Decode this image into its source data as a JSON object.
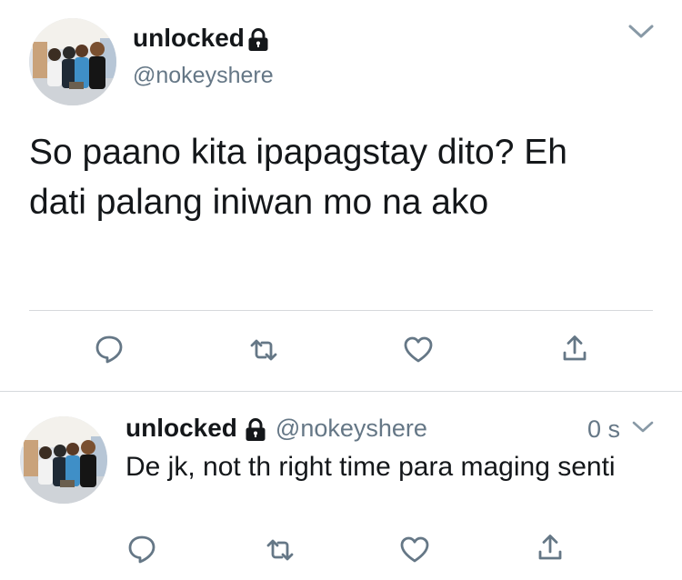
{
  "main_tweet": {
    "display_name": "unlocked",
    "handle": "@nokeyshere",
    "text": "So paano kita ipapagstay dito? Eh dati palang iniwan mo na ako"
  },
  "reply_tweet": {
    "display_name": "unlocked",
    "handle": "@nokeyshere",
    "timestamp": "0 s",
    "text": "De jk, not th right time para maging senti"
  },
  "icons": {
    "lock": "lock-icon",
    "menu": "chevron-down-icon",
    "reply": "reply-icon",
    "retweet": "retweet-icon",
    "like": "heart-icon",
    "share": "share-icon"
  },
  "colors": {
    "text": "#14171a",
    "secondary": "#657786",
    "icon": "#657786",
    "divider": "#d6d9dc"
  }
}
